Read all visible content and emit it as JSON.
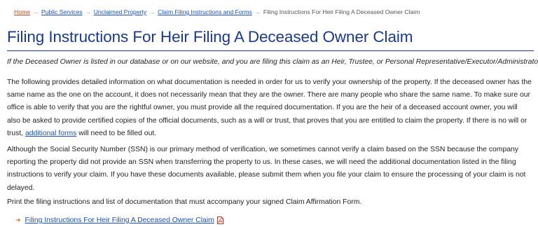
{
  "breadcrumb": {
    "items": [
      "Home",
      "Public Services",
      "Unclaimed Property",
      "Claim Filing Instructions and Forms"
    ],
    "current": "Filing Instructions For Heir Filing A Deceased Owner Claim",
    "separator": "→"
  },
  "page": {
    "title": "Filing Instructions For Heir Filing A Deceased Owner Claim",
    "intro": "If the Deceased Owner is listed in our database or on our website, and you are filing this claim as an Heir, Trustee, or Personal Representative/Executor/Administrator",
    "p1_before": "The following provides detailed information on what documentation is needed in order for us to verify your ownership of the property. If the deceased owner has the same name as the one on the account, it does not necessarily mean that they are the owner. There are many people who share the same name. To make sure our office is able to verify that you are the rightful owner, you must provide all the required documentation. If you are the heir of a deceased account owner, you will also be asked to provide certified copies of  the official documents, such as a will or trust, that proves that you are entitled to claim the property. If there is no will or trust, ",
    "p1_link": "additional forms",
    "p1_after": " will need to be filled out.",
    "p2": "Although the Social Security Number (SSN) is our primary method of verification, we sometimes cannot verify a claim based on the SSN because the company reporting the property did not provide an SSN when transferring the property to us. In these cases, we will need the additional documentation listed in the filing instructions to verify your claim. If you have these documents available, please submit them when you file your claim to ensure the processing of your claim is not delayed.",
    "p3": "Print the filing instructions and list of documentation that must accompany your signed Claim Affirmation Form.",
    "doc_link": "Filing Instructions For Heir Filing A Deceased Owner Claim"
  },
  "icons": {
    "doc_link_icon": "pdf-icon",
    "bullet_icon": "arrow-icon",
    "breadcrumb_separator_icon": "arrow-icon"
  },
  "colors": {
    "title": "#1a3a8c",
    "link": "#1a4fc4",
    "home_link": "#b5471b",
    "arrow": "#d4792a"
  }
}
